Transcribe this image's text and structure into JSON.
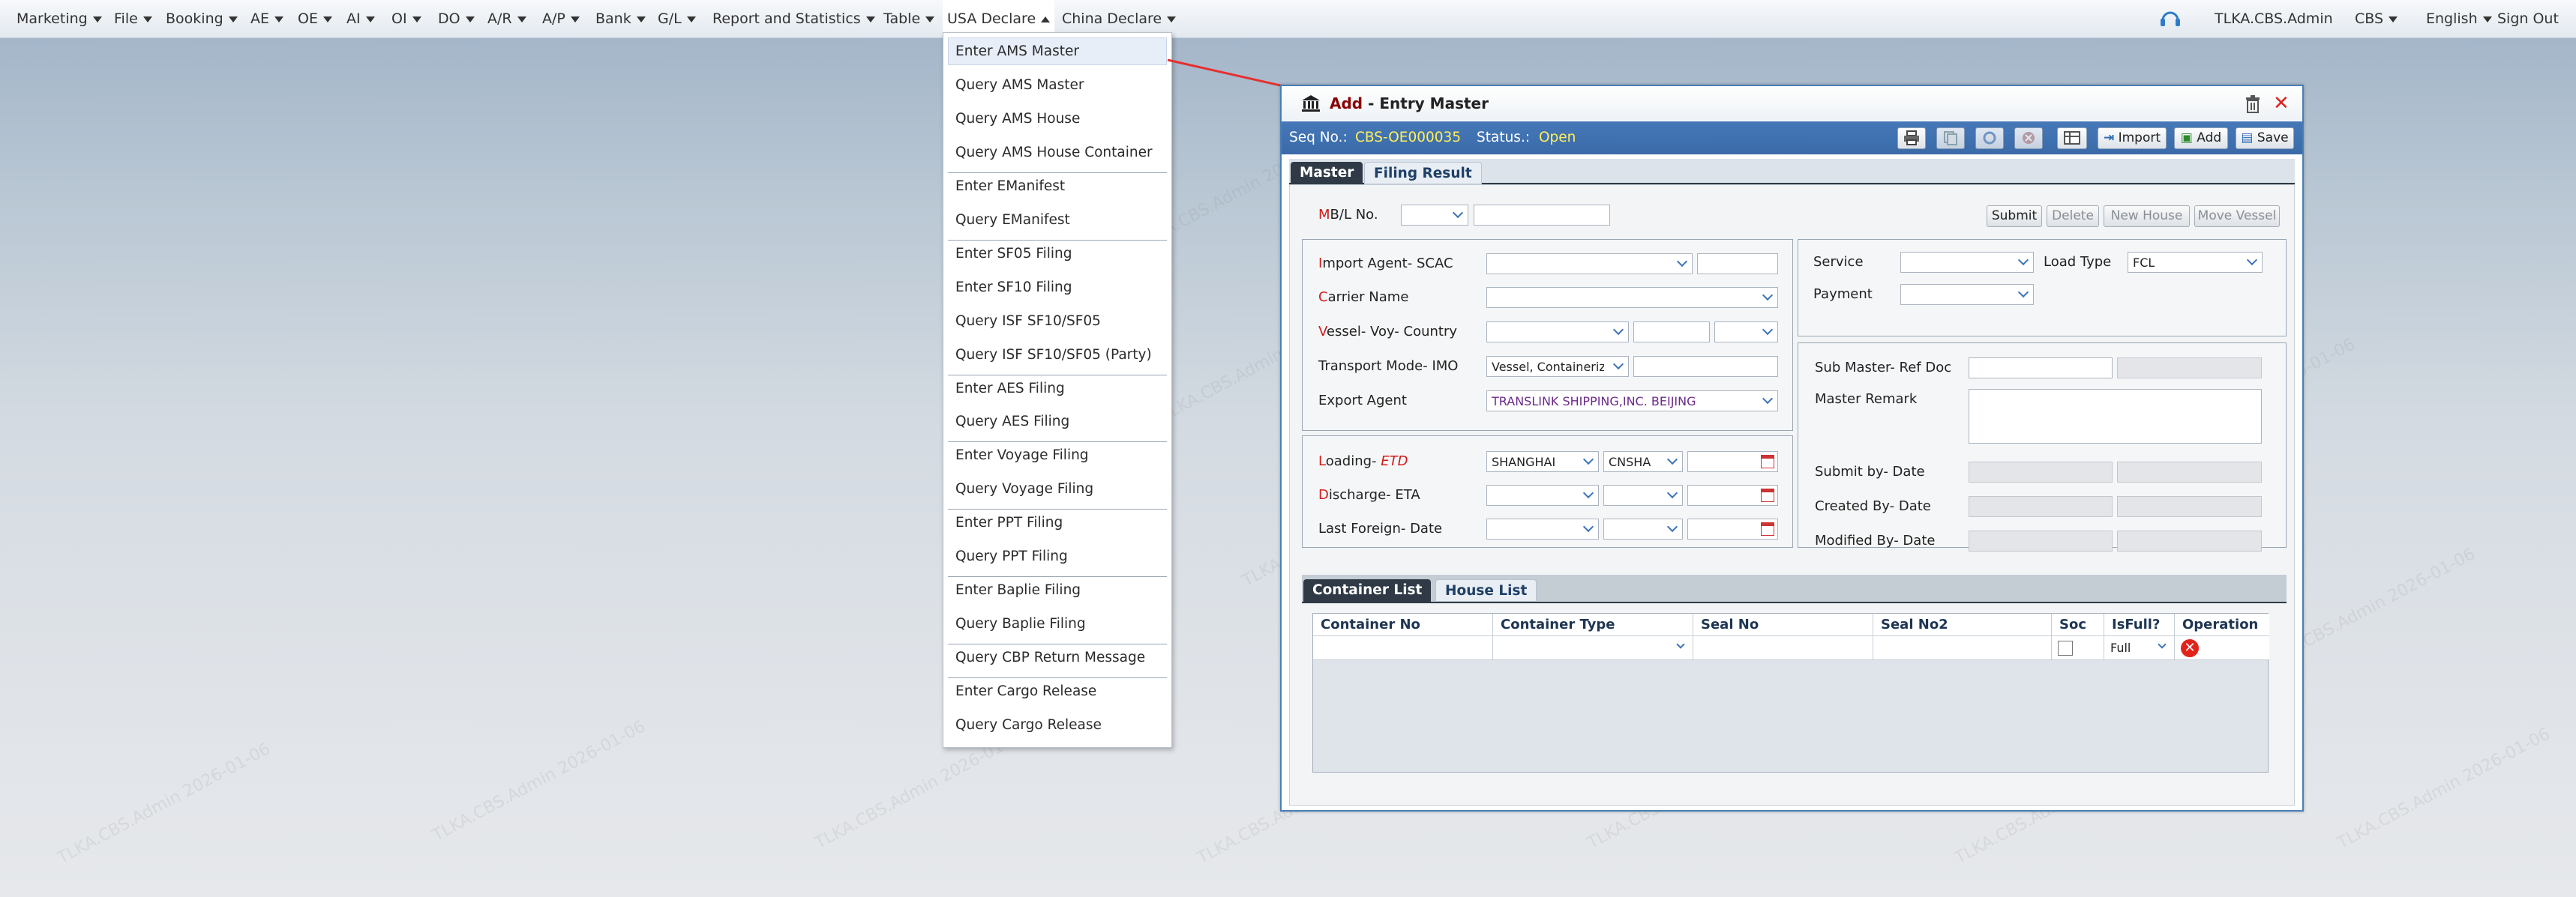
{
  "menubar": {
    "items": [
      "Marketing",
      "File",
      "Booking",
      "AE",
      "OE",
      "AI",
      "OI",
      "DO",
      "A/R",
      "A/P",
      "Bank",
      "G/L",
      "Report and Statistics",
      "Table",
      "USA Declare",
      "China Declare"
    ],
    "user": "TLKA.CBS.Admin",
    "company": "CBS",
    "language": "English",
    "signout": "Sign Out"
  },
  "dropdown": {
    "items": [
      "Enter AMS Master",
      "Query AMS Master",
      "Query AMS House",
      "Query AMS House Container",
      "Enter EManifest",
      "Query EManifest",
      "Enter SF05 Filing",
      "Enter SF10 Filing",
      "Query ISF SF10/SF05",
      "Query ISF SF10/SF05 (Party)",
      "Enter AES Filing",
      "Query AES Filing",
      "Enter Voyage Filing",
      "Query Voyage Filing",
      "Enter PPT Filing",
      "Query PPT Filing",
      "Enter Baplie Filing",
      "Query Baplie Filing",
      "Query CBP Return Message",
      "Enter Cargo Release",
      "Query Cargo Release"
    ]
  },
  "window": {
    "title_add": "Add",
    "title_sep": " - ",
    "title_rest": "Entry Master",
    "seq_label": "Seq No.:",
    "seq_value": "CBS-OE000035",
    "status_label": "Status.:",
    "status_value": "Open",
    "btn_import": "Import",
    "btn_add": "Add",
    "btn_save": "Save"
  },
  "tabs": {
    "master": "Master",
    "filing": "Filing Result"
  },
  "form": {
    "mbl_first": "M",
    "mbl_rest": "B/L No.",
    "btn_submit": "Submit",
    "btn_delete": "Delete",
    "btn_newhouse": "New House",
    "btn_movevessel": "Move Vessel",
    "import_agent_first": "I",
    "import_agent_rest": "mport Agent- SCAC",
    "carrier_first": "C",
    "carrier_rest": "arrier Name",
    "vessel_first": "V",
    "vessel_rest": "essel- Voy- Country",
    "transport_label": "Transport Mode- IMO",
    "transport_value": "Vessel, Containerize",
    "export_agent_label": "Export Agent",
    "export_agent_value": "TRANSLINK SHIPPING,INC. BEIJING",
    "loading_first": "L",
    "loading_rest": "oading- ",
    "loading_etd": "ETD",
    "loading_port": "SHANGHAI",
    "loading_code": "CNSHA",
    "discharge_first": "D",
    "discharge_rest": "ischarge- ETA",
    "lastforeign_label": "Last Foreign- Date",
    "service_label": "Service",
    "loadtype_label": "Load Type",
    "loadtype_value": "FCL",
    "payment_label": "Payment",
    "submaster_label": "Sub Master- Ref Doc",
    "remark_label": "Master Remark",
    "submitby_label": "Submit by- Date",
    "createdby_label": "Created By- Date",
    "modifiedby_label": "Modified By- Date"
  },
  "subtabs": {
    "container": "Container List",
    "house": "House List"
  },
  "grid": {
    "headers": [
      "Container No",
      "Container Type",
      "Seal No",
      "Seal No2",
      "Soc",
      "IsFull?",
      "Operation"
    ],
    "row": {
      "isfull": "Full"
    }
  },
  "watermark": "TLKA.CBS.Admin 2026-01-06"
}
